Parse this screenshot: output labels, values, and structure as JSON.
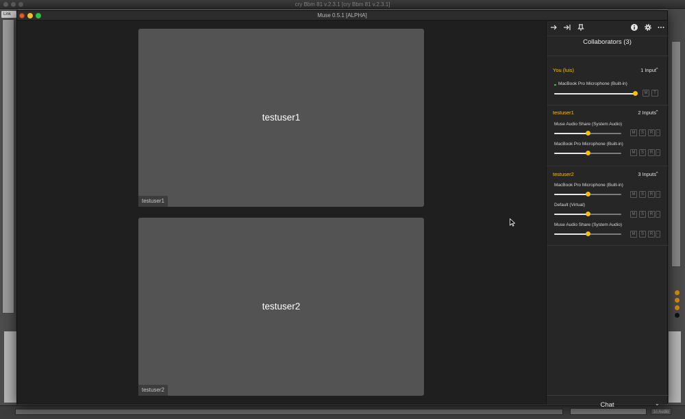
{
  "host": {
    "title": "cry Bbm 81 v.2.3.1  [cry Bbm 81 v.2.3.1]",
    "link_label": "Link",
    "audio_label": "1/i Audio"
  },
  "window": {
    "title": "Muse 0.5.1 [ALPHA]"
  },
  "tiles": [
    {
      "name": "testuser1",
      "tag": "testuser1"
    },
    {
      "name": "testuser2",
      "tag": "testuser2"
    }
  ],
  "toolbar": {
    "icons": [
      "arrow-right-icon",
      "collapse-right-icon",
      "pin-icon",
      "info-icon",
      "gear-icon",
      "more-icon"
    ]
  },
  "sidebar": {
    "title": "Collaborators (3)",
    "groups": [
      {
        "name": "You (luis)",
        "count": "1 Input",
        "inputs": [
          {
            "label": "MacBook Pro Microphone (Built-in)",
            "level": 1.0,
            "buttons": [
              "M",
              "T"
            ]
          }
        ]
      },
      {
        "name": "testuser1",
        "count": "2 Inputs",
        "inputs": [
          {
            "label": "Muse Audio Share (System Audio)",
            "level": 0.5,
            "buttons": [
              "M",
              "S",
              "R",
              "-"
            ]
          },
          {
            "label": "MacBook Pro Microphone (Built-in)",
            "level": 0.5,
            "buttons": [
              "M",
              "S",
              "R",
              "-"
            ]
          }
        ]
      },
      {
        "name": "testuser2",
        "count": "3 Inputs",
        "inputs": [
          {
            "label": "MacBook Pro Microphone (Built-in)",
            "level": 0.5,
            "buttons": [
              "M",
              "S",
              "R",
              "-"
            ]
          },
          {
            "label": "Default (Virtual)",
            "level": 0.5,
            "buttons": [
              "M",
              "S",
              "R",
              "-"
            ]
          },
          {
            "label": "Muse Audio Share (System Audio)",
            "level": 0.5,
            "buttons": [
              "M",
              "S",
              "R",
              "-"
            ]
          }
        ]
      }
    ],
    "chat_label": "Chat"
  },
  "colors": {
    "accent": "#f5c000",
    "tile": "#535353",
    "panel": "#262626"
  }
}
